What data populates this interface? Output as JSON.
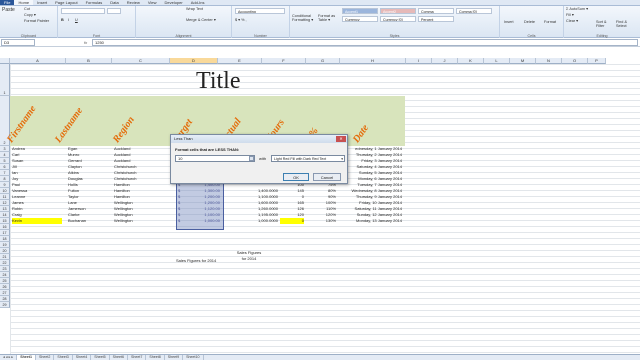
{
  "ribbon": {
    "tabs": [
      "File",
      "Home",
      "Insert",
      "Page Layout",
      "Formulas",
      "Data",
      "Review",
      "View",
      "Developer",
      "Add-Ins"
    ],
    "clipboard": {
      "cut": "Cut",
      "copy": "Copy ▾",
      "paste": "Paste",
      "format_painter": "Format Painter",
      "label": "Clipboard"
    },
    "font": {
      "label": "Font"
    },
    "alignment": {
      "wrap": "Wrap Text",
      "merge": "Merge & Center ▾",
      "label": "Alignment"
    },
    "number": {
      "format": "Accounting",
      "label": "Number"
    },
    "styles": {
      "conditional": "Conditional Formatting ▾",
      "format_table": "Format as Table ▾",
      "items": [
        [
          "Accent1",
          "Accent2",
          "Comma",
          "Comma [0]"
        ],
        [
          "Currency",
          "Currency [0]",
          "Percent",
          ""
        ]
      ],
      "label": "Styles"
    },
    "cells": {
      "insert": "Insert",
      "delete": "Delete",
      "format": "Format",
      "label": "Cells"
    },
    "editing": {
      "autosum": "Σ AutoSum ▾",
      "fill": "Fill ▾",
      "clear": "Clear ▾",
      "sort": "Sort & Filter",
      "find": "Find & Select",
      "label": "Editing"
    }
  },
  "formula_bar": {
    "name_box": "D3",
    "fx": "fx",
    "value": "1250"
  },
  "columns": [
    "A",
    "B",
    "C",
    "D",
    "E",
    "F",
    "G",
    "H",
    "I",
    "J",
    "K",
    "L",
    "M",
    "N",
    "O",
    "P"
  ],
  "rows": [
    "1",
    "2",
    "3",
    "4",
    "5",
    "6",
    "7",
    "8",
    "9",
    "10",
    "11",
    "12",
    "13",
    "14",
    "15",
    "16",
    "17",
    "18",
    "19",
    "20",
    "21",
    "22",
    "23",
    "24",
    "25",
    "26",
    "27",
    "28",
    "29"
  ],
  "sheet_title": "Title",
  "headers": [
    "Firstname",
    "Lastname",
    "Region",
    "Target",
    "Actual",
    "Hours",
    "%",
    "Date"
  ],
  "data_rows": [
    [
      "Andrea",
      "Egan",
      "Auckland",
      "$",
      "1,250.00",
      "",
      "",
      "",
      "ednesday, 1 January 2014"
    ],
    [
      "Carl",
      "Munro",
      "Auckland",
      "$",
      "",
      "",
      "",
      "",
      "Thursday, 2 January 2014"
    ],
    [
      "Susan",
      "Gerrard",
      "Auckland",
      "$",
      "",
      "",
      "",
      "",
      "Friday, 3 January 2014"
    ],
    [
      "Jill",
      "Clayton",
      "Christchurch",
      "$",
      "",
      "",
      "",
      "",
      "Saturday, 4 January 2014"
    ],
    [
      "Ian",
      "Atkins",
      "Christchurch",
      "$",
      "",
      "",
      "",
      "",
      "Sunday, 5 January 2014"
    ],
    [
      "Joy",
      "Douglas",
      "Christchurch",
      "$",
      "",
      "",
      "",
      "",
      "Monday, 6 January 2014"
    ],
    [
      "Paul",
      "Hollis",
      "Hamilton",
      "$",
      "1,400.00",
      "",
      "100",
      "75%",
      "Tuesday, 7 January 2014"
    ],
    [
      "Vanessa",
      "Fulton",
      "Hamilton",
      "$",
      "1,300.00",
      "1,400.0000",
      "145",
      "80%",
      "Wednesday, 8 January 2014"
    ],
    [
      "Leanne",
      "Taylor",
      "Hamilton",
      "$",
      "1,200.00",
      "1,100.0000",
      "0",
      "90%",
      "Thursday, 9 January 2014"
    ],
    [
      "James",
      "Lane",
      "Wellington",
      "$",
      "1,200.00",
      "1,600.0000",
      "165",
      "100%",
      "Friday, 10 January 2014"
    ],
    [
      "Robin",
      "Jamerson",
      "Wellington",
      "$",
      "1,120.00",
      "1,260.0000",
      "126",
      "110%",
      "Saturday, 11 January 2014"
    ],
    [
      "Craig",
      "Clarke",
      "Wellington",
      "$",
      "1,100.00",
      "1,195.0000",
      "120",
      "120%",
      "Sunday, 12 January 2014"
    ],
    [
      "Kevin",
      "Buchanan",
      "Wellington",
      "$",
      "1,000.00",
      "1,000.0000",
      "0",
      "130%",
      "Monday, 13 January 2014"
    ]
  ],
  "notes": {
    "d_label": "Sales Figures for 2014",
    "e_label": "Sales Figures for 2014"
  },
  "dialog": {
    "title": "Less Than",
    "prompt": "Format cells that are LESS THAN:",
    "value": "10",
    "with_label": "with",
    "format_option": "Light Red Fill with Dark Red Text",
    "ok": "OK",
    "cancel": "Cancel"
  },
  "sheet_tabs": [
    "Sheet1",
    "Sheet2",
    "Sheet3",
    "Sheet4",
    "Sheet5",
    "Sheet6",
    "Sheet7",
    "Sheet8",
    "Sheet9",
    "Sheet10"
  ],
  "colors": {
    "header_band": "#d8e4bc",
    "header_text": "#e46c0a",
    "highlight": "#ffff00",
    "selection": "#4a5fa0"
  }
}
